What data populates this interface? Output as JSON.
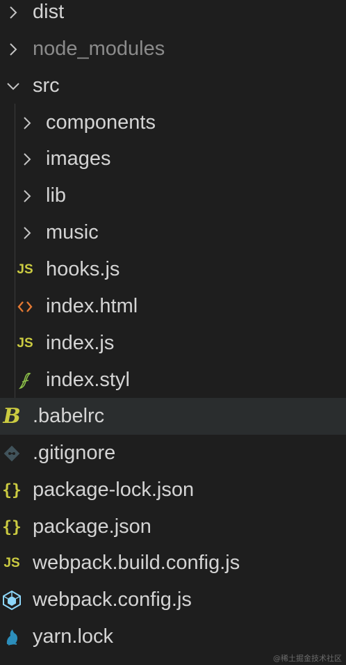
{
  "explorer": {
    "items": [
      {
        "label": "dist",
        "type": "folder",
        "state": "collapsed",
        "depth": 0,
        "icon": "chevron-right-icon"
      },
      {
        "label": "node_modules",
        "type": "folder",
        "state": "collapsed",
        "depth": 0,
        "icon": "chevron-right-icon",
        "dimmed": true
      },
      {
        "label": "src",
        "type": "folder",
        "state": "expanded",
        "depth": 0,
        "icon": "chevron-down-icon"
      },
      {
        "label": "components",
        "type": "folder",
        "state": "collapsed",
        "depth": 1,
        "icon": "chevron-right-icon"
      },
      {
        "label": "images",
        "type": "folder",
        "state": "collapsed",
        "depth": 1,
        "icon": "chevron-right-icon"
      },
      {
        "label": "lib",
        "type": "folder",
        "state": "collapsed",
        "depth": 1,
        "icon": "chevron-right-icon"
      },
      {
        "label": "music",
        "type": "folder",
        "state": "collapsed",
        "depth": 1,
        "icon": "chevron-right-icon"
      },
      {
        "label": "hooks.js",
        "type": "file",
        "depth": 1,
        "icon": "javascript-file-icon",
        "badge": "JS"
      },
      {
        "label": "index.html",
        "type": "file",
        "depth": 1,
        "icon": "html-file-icon"
      },
      {
        "label": "index.js",
        "type": "file",
        "depth": 1,
        "icon": "javascript-file-icon",
        "badge": "JS"
      },
      {
        "label": "index.styl",
        "type": "file",
        "depth": 1,
        "icon": "stylus-file-icon"
      },
      {
        "label": ".babelrc",
        "type": "file",
        "depth": 0,
        "icon": "babel-file-icon",
        "badge": "B",
        "selected": true
      },
      {
        "label": ".gitignore",
        "type": "file",
        "depth": 0,
        "icon": "git-file-icon"
      },
      {
        "label": "package-lock.json",
        "type": "file",
        "depth": 0,
        "icon": "json-file-icon",
        "badge": "{}"
      },
      {
        "label": "package.json",
        "type": "file",
        "depth": 0,
        "icon": "json-file-icon",
        "badge": "{}"
      },
      {
        "label": "webpack.build.config.js",
        "type": "file",
        "depth": 0,
        "icon": "javascript-file-icon",
        "badge": "JS"
      },
      {
        "label": "webpack.config.js",
        "type": "file",
        "depth": 0,
        "icon": "webpack-file-icon"
      },
      {
        "label": "yarn.lock",
        "type": "file",
        "depth": 0,
        "icon": "yarn-file-icon"
      }
    ]
  },
  "watermark": "@稀土掘金技术社区",
  "colors": {
    "background": "#1e1e1e",
    "selected_row": "#2a2d2e",
    "text": "#d4d4d4",
    "dimmed_text": "#8b8b8b",
    "chevron": "#c5c5c5",
    "js_yellow": "#cbcb41",
    "html_orange": "#e37933",
    "git_gray": "#41535b",
    "webpack_blue": "#8dd6f9",
    "yarn_blue": "#2c8ebb",
    "stylus_green": "#8dc149"
  }
}
